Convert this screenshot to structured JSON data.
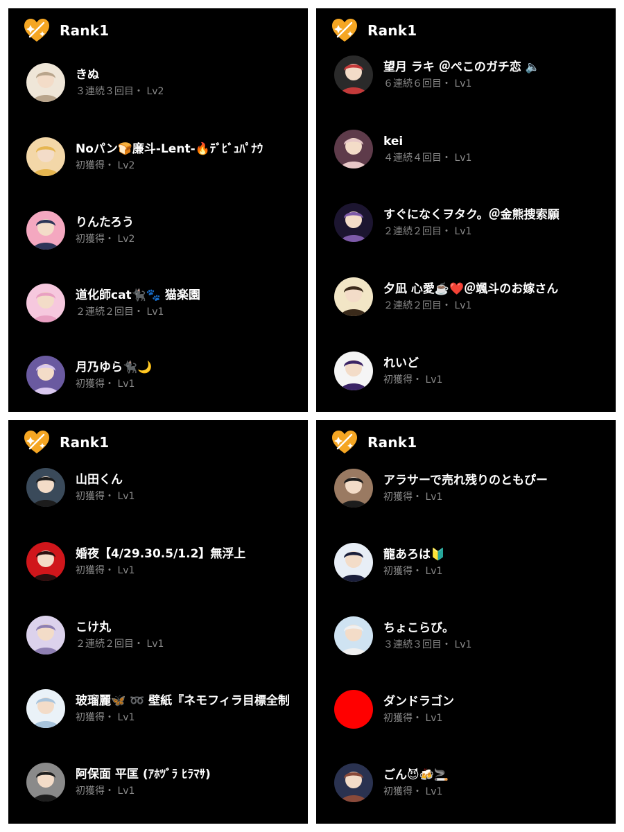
{
  "colors": {
    "background": "#000000",
    "divider": "#ffffff",
    "name_text": "#ffffff",
    "meta_text": "#8a8a8a",
    "heart": "#f5a623"
  },
  "panels": [
    {
      "badge_icon": "orange-heart-icon",
      "rank_label": "Rank1",
      "users": [
        {
          "name": "きぬ",
          "meta": "３連続３回目・ Lv2",
          "avatar": {
            "bg": "#efe6d8",
            "fg": "#b9a58c"
          }
        },
        {
          "name": "Noパン🍞廉斗-Lent-🔥ﾃﾞﾋﾞｭﾊﾟﾅｳ",
          "meta": "初獲得・ Lv2",
          "avatar": {
            "bg": "#f3d7a8",
            "fg": "#e6b650"
          }
        },
        {
          "name": "りんたろう",
          "meta": "初獲得・ Lv2",
          "avatar": {
            "bg": "#f4a8c0",
            "fg": "#2d3558"
          }
        },
        {
          "name": "道化師cat🐈‍⬛🐾 猫楽園",
          "meta": "２連続２回目・ Lv1",
          "avatar": {
            "bg": "#f6c8de",
            "fg": "#e9a0c2"
          }
        },
        {
          "name": "月乃ゆら🐈‍⬛🌙",
          "meta": "初獲得・ Lv1",
          "avatar": {
            "bg": "#6a5aa0",
            "fg": "#d9c8ef"
          }
        }
      ]
    },
    {
      "badge_icon": "orange-heart-icon",
      "rank_label": "Rank1",
      "users": [
        {
          "name": "望月 ラキ ＠ぺこのガチ恋 🔈",
          "meta": "６連続６回目・ Lv1",
          "avatar": {
            "bg": "#2a2a2a",
            "fg": "#c43a3a"
          }
        },
        {
          "name": "kei",
          "meta": "４連続４回目・ Lv1",
          "avatar": {
            "bg": "#5e3b4a",
            "fg": "#e8c8c8"
          }
        },
        {
          "name": "すぐになくヲタク。＠金熊捜索願",
          "meta": "２連続２回目・ Lv1",
          "avatar": {
            "bg": "#1c1530",
            "fg": "#7d5aa8"
          }
        },
        {
          "name": "夕凪 心愛☕️❤️＠颯斗のお嫁さん",
          "meta": "２連続２回目・ Lv1",
          "avatar": {
            "bg": "#f2e6c6",
            "fg": "#3a2a1a"
          }
        },
        {
          "name": "れいど",
          "meta": "初獲得・ Lv1",
          "avatar": {
            "bg": "#f5f5f5",
            "fg": "#3b2466"
          }
        }
      ]
    },
    {
      "badge_icon": "orange-heart-icon",
      "rank_label": "Rank1",
      "users": [
        {
          "name": "山田くん",
          "meta": "初獲得・ Lv1",
          "avatar": {
            "bg": "#3a4a5a",
            "fg": "#1c1c1c"
          }
        },
        {
          "name": "婚夜【4/29.30.5/1.2】無浮上",
          "meta": "初獲得・ Lv1",
          "avatar": {
            "bg": "#d0161b",
            "fg": "#2a1010"
          }
        },
        {
          "name": "こけ丸",
          "meta": "２連続２回目・ Lv1",
          "avatar": {
            "bg": "#dcd2ec",
            "fg": "#8e7fb2"
          }
        },
        {
          "name": "玻瑠麗🦋 ➿ 壁紙『ネモフィラ目標全制",
          "meta": "初獲得・ Lv1",
          "avatar": {
            "bg": "#eaf2f8",
            "fg": "#a8c4dc"
          }
        },
        {
          "name": "阿保面 平匡 (ｱﾎﾂﾞﾗ ﾋﾗﾏｻ)",
          "meta": "初獲得・ Lv1",
          "avatar": {
            "bg": "#8a8a8a",
            "fg": "#1e1e1e"
          }
        }
      ]
    },
    {
      "badge_icon": "orange-heart-icon",
      "rank_label": "Rank1",
      "users": [
        {
          "name": "アラサーで売れ残りのともぴー",
          "meta": "初獲得・ Lv1",
          "avatar": {
            "bg": "#9a7a62",
            "fg": "#1c1c1c"
          }
        },
        {
          "name": "龍あろは🔰",
          "meta": "初獲得・ Lv1",
          "avatar": {
            "bg": "#e8eef6",
            "fg": "#1a1e3a"
          }
        },
        {
          "name": "ちょこらび。",
          "meta": "３連続３回目・ Lv1",
          "avatar": {
            "bg": "#cfe3f2",
            "fg": "#f0f0f0"
          }
        },
        {
          "name": "ダンドラゴン",
          "meta": "初獲得・ Lv1",
          "avatar": {
            "bg": "#ff0000",
            "fg": "#ff0000"
          }
        },
        {
          "name": "ごん😈🍻🚬",
          "meta": "初獲得・ Lv1",
          "avatar": {
            "bg": "#2a3250",
            "fg": "#8a4a3a"
          }
        }
      ]
    }
  ]
}
